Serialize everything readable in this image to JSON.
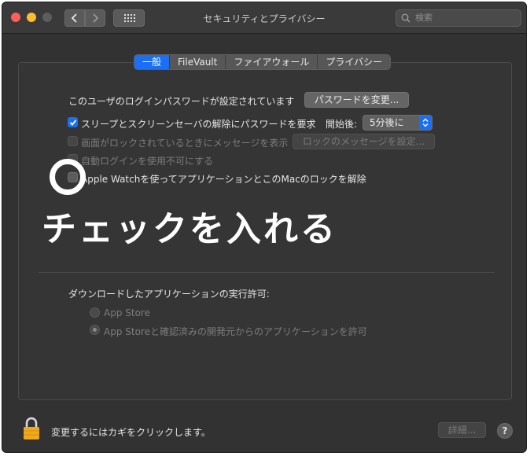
{
  "window": {
    "title": "セキュリティとプライバシー"
  },
  "toolbar": {
    "search_placeholder": "検索"
  },
  "tabs": [
    {
      "label": "一般",
      "active": true
    },
    {
      "label": "FileVault",
      "active": false
    },
    {
      "label": "ファイアウォール",
      "active": false
    },
    {
      "label": "プライバシー",
      "active": false
    }
  ],
  "general": {
    "password_set_label": "このユーザのログインパスワードが設定されています",
    "change_password_button": "パスワードを変更...",
    "require_password": {
      "label": "スリープとスクリーンセーバの解除にパスワードを要求",
      "checked": true
    },
    "start_after_label": "開始後:",
    "start_after_value": "5分後に",
    "show_message": {
      "label": "画面がロックされているときにメッセージを表示",
      "checked": false
    },
    "set_lock_message_button": "ロックのメッセージを設定...",
    "disable_auto_login": {
      "label": "自動ログインを使用不可にする",
      "checked": false
    },
    "apple_watch_unlock": {
      "label": "Apple Watchを使ってアプリケーションとこのMacのロックを解除",
      "checked": false
    },
    "download_section_label": "ダウンロードしたアプリケーションの実行許可:",
    "download_options": [
      {
        "label": "App Store",
        "selected": false
      },
      {
        "label": "App Storeと確認済みの開発元からのアプリケーションを許可",
        "selected": true
      }
    ]
  },
  "annotation": {
    "text": "チェックを入れる"
  },
  "footer": {
    "lock_text": "変更するにはカギをクリックします。",
    "advanced_button": "詳細...",
    "help_button": "?"
  },
  "colors": {
    "accent": "#1a6ff5",
    "window_bg": "#323232",
    "close": "#fe5f57",
    "minimize": "#febc2e"
  }
}
